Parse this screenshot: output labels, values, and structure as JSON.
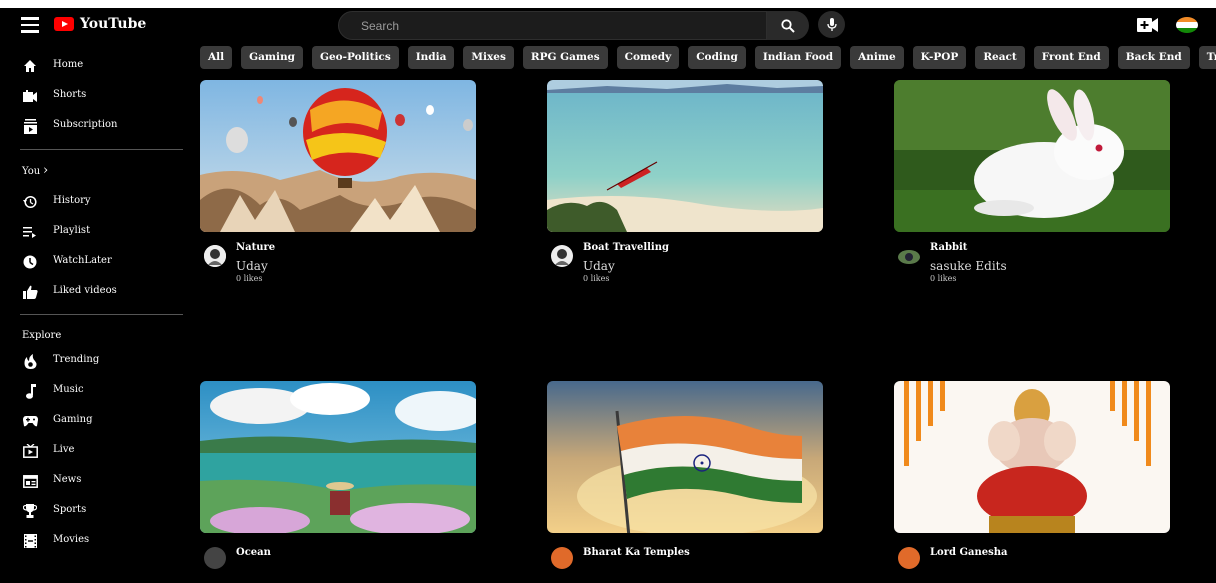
{
  "header": {
    "brand": "YouTube",
    "search_placeholder": "Search"
  },
  "chips": [
    "All",
    "Gaming",
    "Geo-Politics",
    "India",
    "Mixes",
    "RPG Games",
    "Comedy",
    "Coding",
    "Indian Food",
    "Anime",
    "K-POP",
    "React",
    "Front End",
    "Back End",
    "Trailers"
  ],
  "sidebar": {
    "main": [
      {
        "label": "Home",
        "icon": "home-icon"
      },
      {
        "label": "Shorts",
        "icon": "shorts-icon"
      },
      {
        "label": "Subscription",
        "icon": "subscription-icon"
      }
    ],
    "you_label": "You",
    "you": [
      {
        "label": "History",
        "icon": "history-icon"
      },
      {
        "label": "Playlist",
        "icon": "playlist-icon"
      },
      {
        "label": "WatchLater",
        "icon": "watch-later-icon"
      },
      {
        "label": "Liked videos",
        "icon": "like-icon"
      }
    ],
    "explore_label": "Explore",
    "explore": [
      {
        "label": "Trending",
        "icon": "trending-icon"
      },
      {
        "label": "Music",
        "icon": "music-icon"
      },
      {
        "label": "Gaming",
        "icon": "gaming-icon"
      },
      {
        "label": "Live",
        "icon": "live-icon"
      },
      {
        "label": "News",
        "icon": "news-icon"
      },
      {
        "label": "Sports",
        "icon": "sports-icon"
      },
      {
        "label": "Movies",
        "icon": "movies-icon"
      }
    ]
  },
  "videos": [
    {
      "title": "Nature",
      "channel": "Uday",
      "likes": "0 likes"
    },
    {
      "title": "Boat Travelling",
      "channel": "Uday",
      "likes": "0 likes"
    },
    {
      "title": "Rabbit",
      "channel": "sasuke Edits",
      "likes": "0 likes"
    },
    {
      "title": "Ocean",
      "channel": "",
      "likes": ""
    },
    {
      "title": "Bharat Ka Temples",
      "channel": "",
      "likes": ""
    },
    {
      "title": "Lord Ganesha",
      "channel": "",
      "likes": ""
    }
  ],
  "colors": {
    "accent": "#ff0000",
    "chip_bg": "#3a3a3a",
    "background": "#000000"
  }
}
